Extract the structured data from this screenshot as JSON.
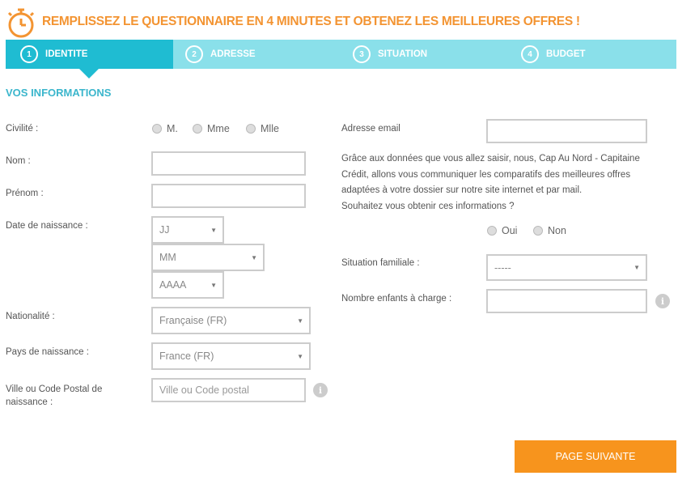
{
  "header": {
    "title": "REMPLISSEZ LE QUESTIONNAIRE EN 4 MINUTES ET OBTENEZ LES MEILLEURES OFFRES !",
    "icon": "stopwatch-icon",
    "color": "#f39432"
  },
  "steps": [
    {
      "num": "1",
      "label": "IDENTITE",
      "active": true
    },
    {
      "num": "2",
      "label": "ADRESSE"
    },
    {
      "num": "3",
      "label": "SITUATION"
    },
    {
      "num": "4",
      "label": "BUDGET"
    }
  ],
  "section_title": "VOS INFORMATIONS",
  "form": {
    "civilite": {
      "label": "Civilité :",
      "options": [
        "M.",
        "Mme",
        "Mlle"
      ]
    },
    "nom": {
      "label": "Nom :",
      "value": ""
    },
    "prenom": {
      "label": "Prénom :",
      "value": ""
    },
    "naissance": {
      "label": "Date de naissance :",
      "jour": "JJ",
      "mois": "MM",
      "annee": "AAAA"
    },
    "nationalite": {
      "label": "Nationalité :",
      "value": "Française (FR)"
    },
    "pays": {
      "label": "Pays de naissance :",
      "value": "France (FR)"
    },
    "ville": {
      "label": "Ville ou Code Postal de naissance :",
      "placeholder": "Ville ou Code postal"
    },
    "email": {
      "label": "Adresse email",
      "value": ""
    },
    "consent": {
      "text": "Grâce aux données que vous allez saisir, nous, Cap Au Nord - Capitaine Crédit, allons vous communiquer les comparatifs des meilleures offres adaptées à votre dossier sur notre site internet et par mail.",
      "question": "Souhaitez vous obtenir ces informations ?",
      "options": [
        "Oui",
        "Non"
      ]
    },
    "situation": {
      "label": "Situation familiale :",
      "value": "-----"
    },
    "enfants": {
      "label": "Nombre enfants à charge :",
      "value": ""
    }
  },
  "next_button": "PAGE SUIVANTE",
  "colors": {
    "active_step": "#1fbcd2",
    "step_bar": "#8ae0ea",
    "button": "#f7941d",
    "section": "#3bb6cc"
  }
}
